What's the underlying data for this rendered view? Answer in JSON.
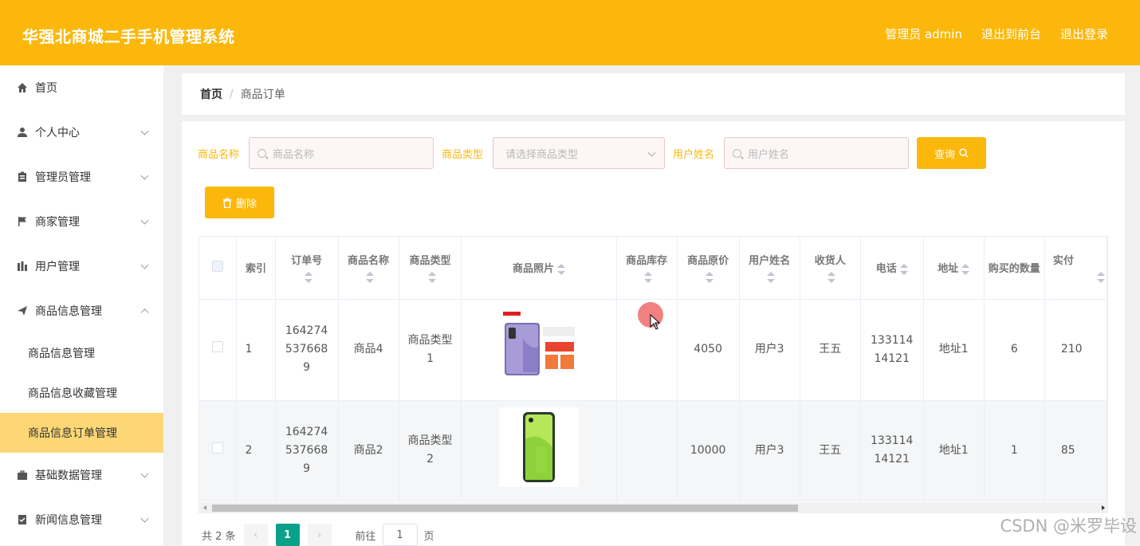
{
  "header": {
    "title": "华强北商城二手手机管理系统",
    "admin_label": "管理员 admin",
    "front_label": "退出到前台",
    "logout_label": "退出登录"
  },
  "sidebar": {
    "items": [
      {
        "label": "首页",
        "icon": "home-icon"
      },
      {
        "label": "个人中心",
        "icon": "user-icon"
      },
      {
        "label": "管理员管理",
        "icon": "clipboard-icon"
      },
      {
        "label": "商家管理",
        "icon": "flag-icon"
      },
      {
        "label": "用户管理",
        "icon": "bar-chart-icon"
      },
      {
        "label": "商品信息管理",
        "icon": "send-icon"
      },
      {
        "label": "基础数据管理",
        "icon": "briefcase-icon"
      },
      {
        "label": "新闻信息管理",
        "icon": "checklist-icon"
      }
    ],
    "sub_items": [
      "商品信息管理",
      "商品信息收藏管理",
      "商品信息订单管理"
    ],
    "active_sub": "商品信息订单管理"
  },
  "breadcrumb": {
    "home": "首页",
    "separator": "/",
    "current": "商品订单"
  },
  "search": {
    "name_label": "商品名称",
    "name_placeholder": "商品名称",
    "type_label": "商品类型",
    "type_placeholder": "请选择商品类型",
    "user_label": "用户姓名",
    "user_placeholder": "用户姓名",
    "query_label": "查询",
    "delete_label": "删除"
  },
  "table": {
    "headers": [
      "索引",
      "订单号",
      "商品名称",
      "商品类型",
      "商品照片",
      "商品库存",
      "商品原价",
      "用户姓名",
      "收货人",
      "电话",
      "地址",
      "购买的数量",
      "实付"
    ],
    "rows": [
      {
        "index": "1",
        "order_no": "1642745376689",
        "name": "商品4",
        "type": "商品类型1",
        "photo": "oneplus-9-phone",
        "stock": "",
        "price": "4050",
        "user": "用户3",
        "receiver": "王五",
        "phone": "13311414121",
        "address": "地址1",
        "qty": "6",
        "paid": "210"
      },
      {
        "index": "2",
        "order_no": "1642745376689",
        "name": "商品2",
        "type": "商品类型2",
        "photo": "realme-gt-neo2-phone",
        "stock": "",
        "price": "10000",
        "user": "用户3",
        "receiver": "王五",
        "phone": "13311414121",
        "address": "地址1",
        "qty": "1",
        "paid": "85"
      }
    ]
  },
  "pagination": {
    "total": "共 2 条",
    "current": "1",
    "goto_label": "前往",
    "goto_value": "1",
    "page_suffix": "页"
  },
  "watermark": "CSDN @米罗毕设",
  "colors": {
    "accent": "#fbb80b",
    "active_sub": "#fdd776",
    "page_num": "#0aa18a"
  }
}
